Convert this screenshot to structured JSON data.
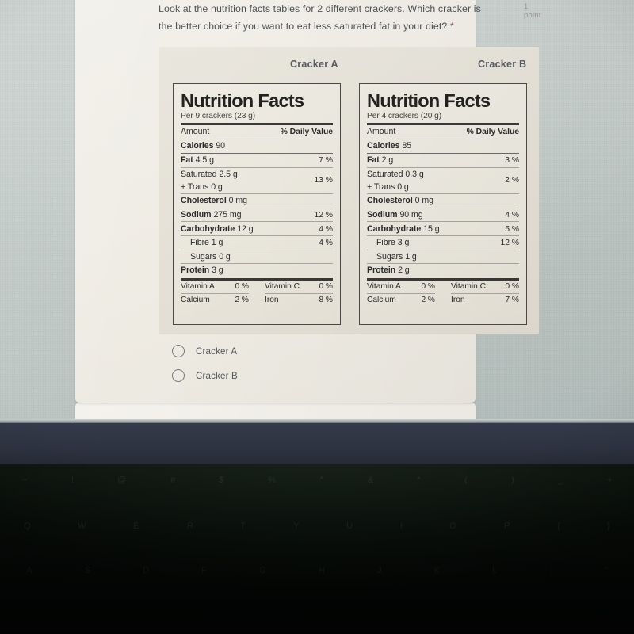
{
  "question": {
    "text_line1": "Look at the nutrition facts tables for 2 different crackers. Which cracker is",
    "text_line2": "the better choice if you want to eat less saturated fat in your diet?",
    "required_marker": "*",
    "points": "1 point"
  },
  "image": {
    "caption_a": "Cracker A",
    "caption_b": "Cracker B",
    "glare": "lens-flare-spot"
  },
  "labels": [
    {
      "id": "cracker-a",
      "title": "Nutrition Facts",
      "serving": "Per 9 crackers (23 g)",
      "col_amount": "Amount",
      "col_dv": "% Daily Value",
      "calories_name": "Calories",
      "calories_value": "90",
      "fat_name": "Fat",
      "fat_value": "4.5 g",
      "fat_dv": "7 %",
      "saturated_name": "Saturated",
      "saturated_value": "2.5 g",
      "trans_name": "+ Trans",
      "trans_value": "0 g",
      "satfat_dv": "13 %",
      "cholesterol_name": "Cholesterol",
      "cholesterol_value": "0 mg",
      "sodium_name": "Sodium",
      "sodium_value": "275 mg",
      "sodium_dv": "12 %",
      "carb_name": "Carbohydrate",
      "carb_value": "12 g",
      "carb_dv": "4 %",
      "fibre_name": "Fibre",
      "fibre_value": "1 g",
      "fibre_dv": "4 %",
      "sugars_name": "Sugars",
      "sugars_value": "0 g",
      "protein_name": "Protein",
      "protein_value": "3 g",
      "vita_name": "Vitamin A",
      "vita_value": "0 %",
      "vitc_name": "Vitamin C",
      "vitc_value": "0 %",
      "calcium_name": "Calcium",
      "calcium_value": "2 %",
      "iron_name": "Iron",
      "iron_value": "8 %"
    },
    {
      "id": "cracker-b",
      "title": "Nutrition Facts",
      "serving": "Per 4 crackers (20 g)",
      "col_amount": "Amount",
      "col_dv": "% Daily Value",
      "calories_name": "Calories",
      "calories_value": "85",
      "fat_name": "Fat",
      "fat_value": "2 g",
      "fat_dv": "3 %",
      "saturated_name": "Saturated",
      "saturated_value": "0.3 g",
      "trans_name": "+ Trans",
      "trans_value": "0 g",
      "satfat_dv": "2 %",
      "cholesterol_name": "Cholesterol",
      "cholesterol_value": "0 mg",
      "sodium_name": "Sodium",
      "sodium_value": "90 mg",
      "sodium_dv": "4 %",
      "carb_name": "Carbohydrate",
      "carb_value": "15 g",
      "carb_dv": "5 %",
      "fibre_name": "Fibre",
      "fibre_value": "3 g",
      "fibre_dv": "12 %",
      "sugars_name": "Sugars",
      "sugars_value": "1 g",
      "protein_name": "Protein",
      "protein_value": "2 g",
      "vita_name": "Vitamin A",
      "vita_value": "0 %",
      "vitc_name": "Vitamin C",
      "vitc_value": "0 %",
      "calcium_name": "Calcium",
      "calcium_value": "2 %",
      "iron_name": "Iron",
      "iron_value": "7 %"
    }
  ],
  "options": [
    {
      "label": "Cracker A",
      "selected": false
    },
    {
      "label": "Cracker B",
      "selected": false
    }
  ],
  "colors": {
    "page_background": "#c2cbc8",
    "card_background": "#f0ede6",
    "label_background": "#eae7dd",
    "text": "#4e5257",
    "label_text": "#2b2b2b",
    "bezel": "#2e3442",
    "glare": "#ffca4e"
  },
  "keyboard_hint_rows": [
    [
      "~",
      "!",
      "@",
      "#",
      "$",
      "%",
      "^",
      "&",
      "*",
      "(",
      ")",
      "_",
      "+"
    ],
    [
      "Q",
      "W",
      "E",
      "R",
      "T",
      "Y",
      "U",
      "I",
      "O",
      "P",
      "{",
      "}"
    ],
    [
      "A",
      "S",
      "D",
      "F",
      "G",
      "H",
      "J",
      "K",
      "L",
      ":",
      "\""
    ]
  ]
}
